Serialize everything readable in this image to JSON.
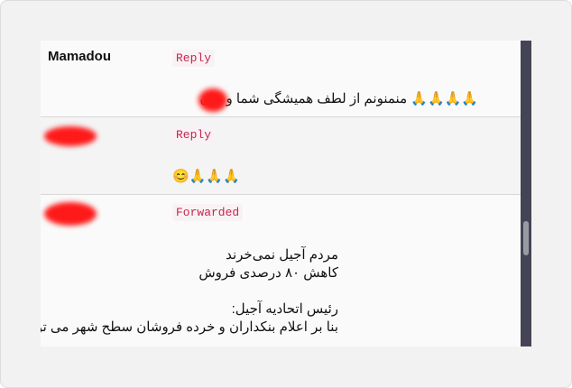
{
  "messages": [
    {
      "sender": "Mamadou",
      "tag": "Reply",
      "lines": [
        "🙏🙏🙏🙏 منمنونم از لطف همیشگی شما و     جان"
      ]
    },
    {
      "sender": "",
      "tag": "Reply",
      "lines": [
        "😊🙏🙏🙏"
      ]
    },
    {
      "sender": "",
      "tag": "Forwarded",
      "lines": [
        "مردم آجیل نمی‌خرند",
        "کاهش ۸۰ درصدی فروش",
        "",
        "رئیس اتحادیه آجیل:",
        "بنا بر اعلام بنکداران و خرده فروشان سطح شهر می توان"
      ]
    }
  ],
  "colors": {
    "tag_text": "#c7254e",
    "tag_bg": "#f9f2f4",
    "redaction": "#ff1a1a",
    "scrollbar_track": "#444456"
  }
}
